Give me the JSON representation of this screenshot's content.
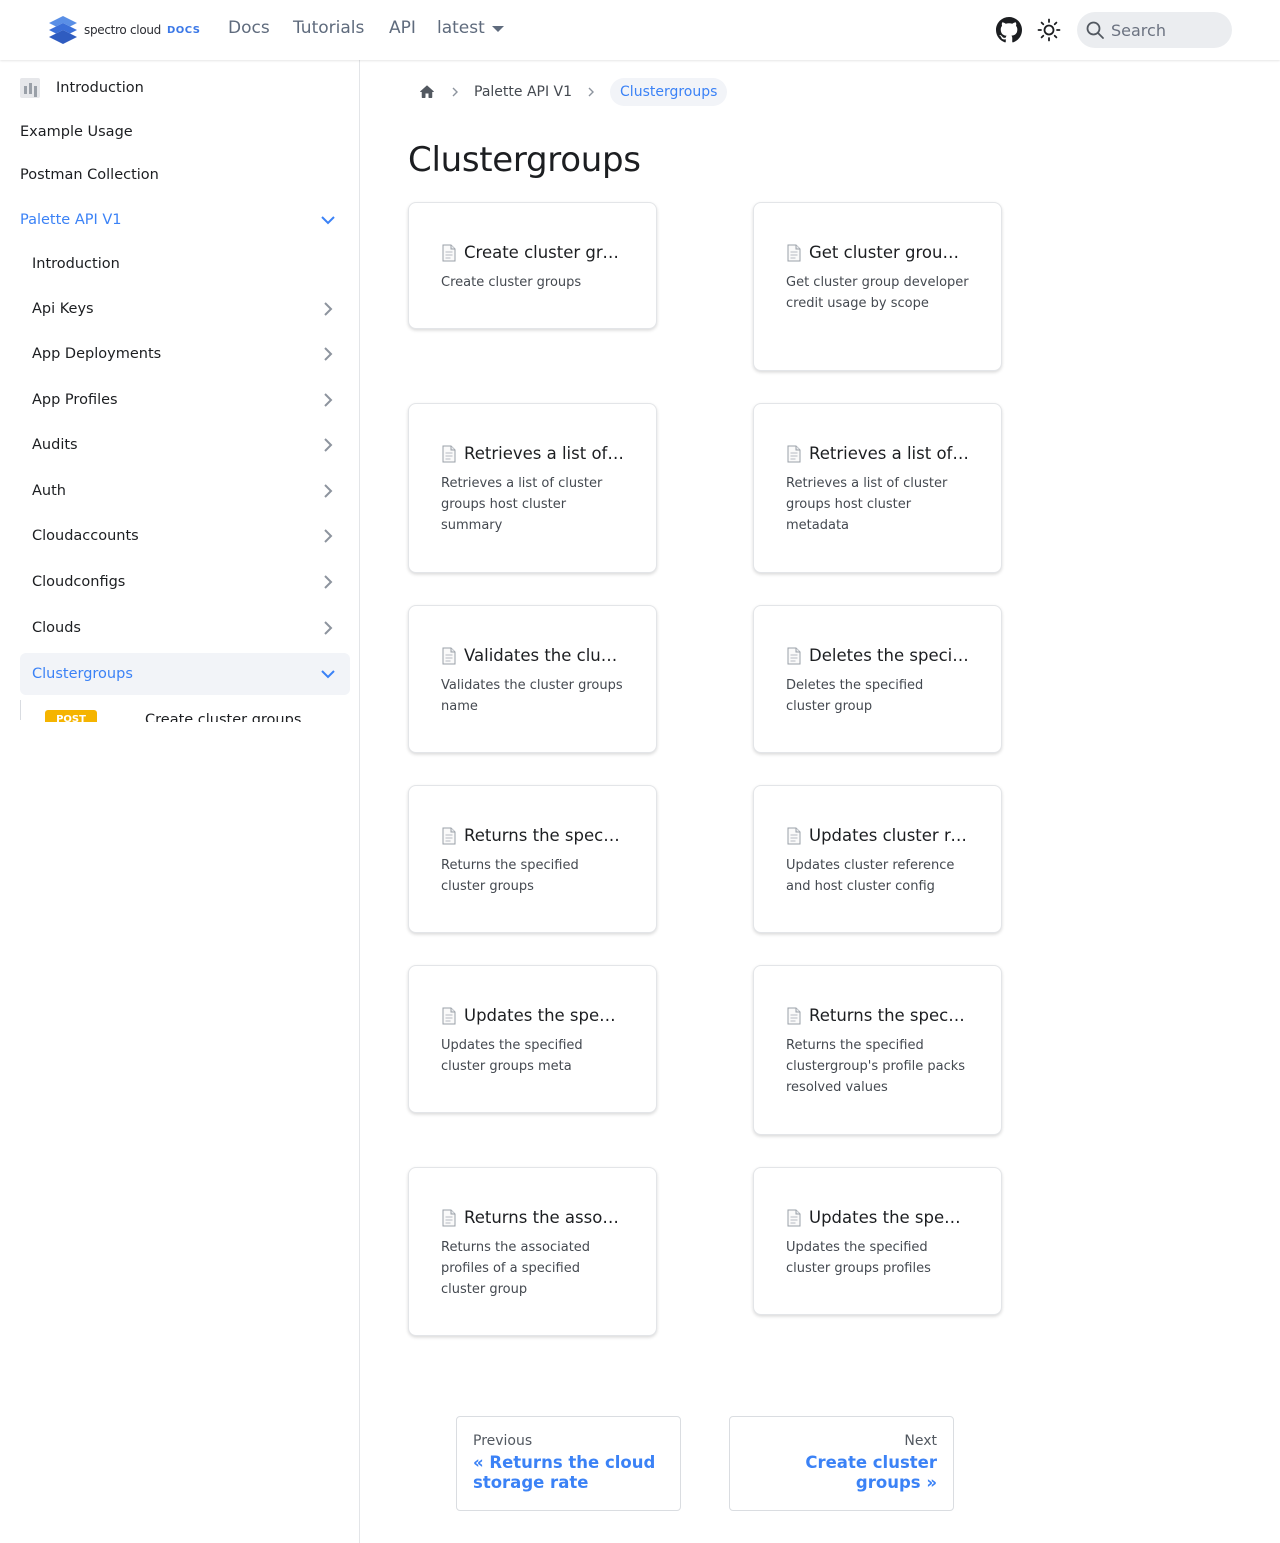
{
  "navbar": {
    "brand_text": "spectro cloud",
    "brand_docs": "DOCS",
    "links": [
      "Docs",
      "Tutorials",
      "API"
    ],
    "version": "latest",
    "search_placeholder": "Search"
  },
  "sidebar": {
    "top_items": [
      "Introduction",
      "Example Usage",
      "Postman Collection",
      "Palette API V1"
    ],
    "children": [
      "Introduction",
      "Api Keys",
      "App Deployments",
      "App Profiles",
      "Audits",
      "Auth",
      "Cloudaccounts",
      "Cloudconfigs",
      "Clouds",
      "Clustergroups"
    ],
    "sub_item": {
      "method": "POST",
      "label": "Create cluster groups"
    }
  },
  "breadcrumb": {
    "items": [
      "Palette API V1"
    ],
    "active": "Clustergroups"
  },
  "page_title": "Clustergroups",
  "cards": [
    {
      "title": "Create cluster groups",
      "desc": "Create cluster groups"
    },
    {
      "title": "Get cluster group developer credit usage by scope",
      "desc": "Get cluster group developer credit usage by scope"
    },
    {
      "title": "Retrieves a list of cluster groups host cluster summary",
      "desc": "Retrieves a list of cluster groups host cluster summary"
    },
    {
      "title": "Retrieves a list of cluster groups host cluster metadata",
      "desc": "Retrieves a list of cluster groups host cluster metadata"
    },
    {
      "title": "Validates the cluster groups name",
      "desc": "Validates the cluster groups name"
    },
    {
      "title": "Deletes the specified cluster group",
      "desc": "Deletes the specified cluster group"
    },
    {
      "title": "Returns the specified cluster groups",
      "desc": "Returns the specified cluster groups"
    },
    {
      "title": "Updates cluster reference and host cluster config",
      "desc": "Updates cluster reference and host cluster config"
    },
    {
      "title": "Updates the specified cluster groups meta",
      "desc": "Updates the specified cluster groups meta"
    },
    {
      "title": "Returns the specified clustergroup's profile packs resolved values",
      "desc": "Returns the specified clustergroup's profile packs resolved values"
    },
    {
      "title": "Returns the associated profiles of a specified cluster group",
      "desc": "Returns the associated profiles of a specified cluster group"
    },
    {
      "title": "Updates the specified cluster groups profiles",
      "desc": "Updates the specified cluster groups profiles"
    }
  ],
  "pager": {
    "prev_sub": "Previous",
    "prev_label": "« Returns the cloud storage rate",
    "next_sub": "Next",
    "next_label": "Create cluster groups »"
  },
  "colors": {
    "accent": "#3b82f6",
    "post_badge": "#f5b400",
    "brand": "#3b78e7"
  }
}
